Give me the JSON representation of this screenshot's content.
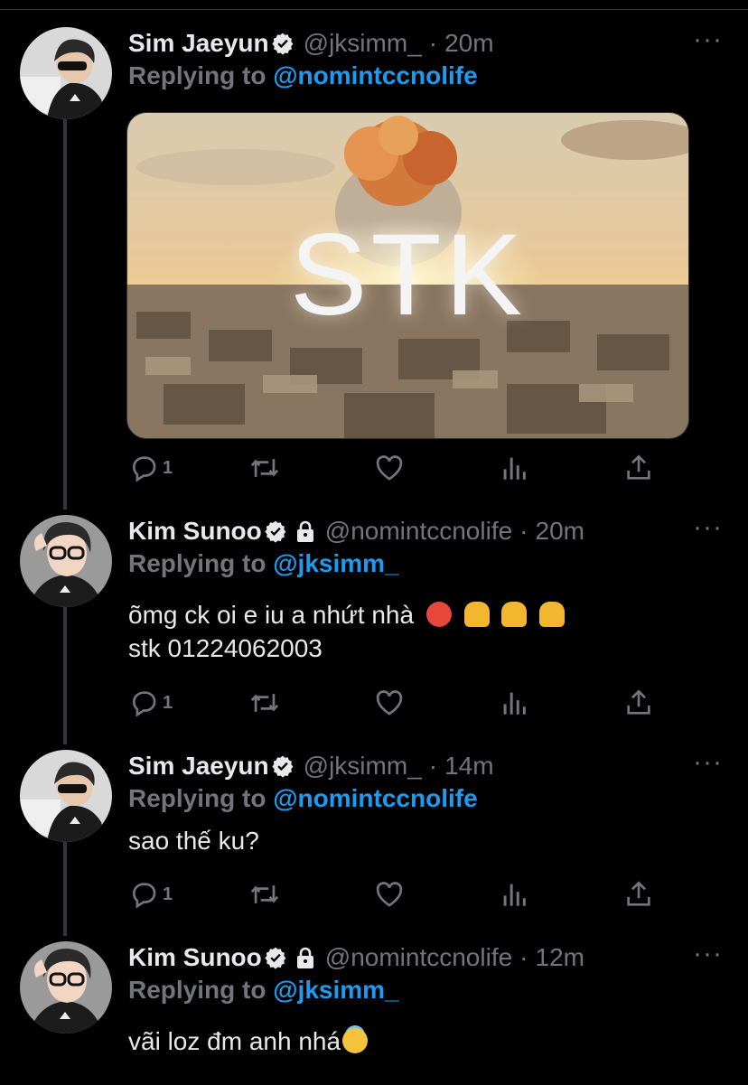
{
  "colors": {
    "background": "#000000",
    "accent": "#1d9bf0",
    "muted": "#71767b",
    "text": "#e7e9ea"
  },
  "tweets": [
    {
      "name": "Sim Jaeyun",
      "verified": true,
      "locked": false,
      "handle": "@jksimm_",
      "time": "20m",
      "replying_label": "Replying to ",
      "replying_to": "@nomintccnolife",
      "text": "",
      "media": {
        "label": "STK"
      },
      "reply_count": "1"
    },
    {
      "name": "Kim Sunoo",
      "verified": true,
      "locked": true,
      "handle": "@nomintccnolife",
      "time": "20m",
      "replying_label": "Replying to ",
      "replying_to": "@jksimm_",
      "text_line1": "õmg ck oi e iu a nhứt nhà",
      "text_line2": "stk 01224062003",
      "reply_count": "1"
    },
    {
      "name": "Sim Jaeyun",
      "verified": true,
      "locked": false,
      "handle": "@jksimm_",
      "time": "14m",
      "replying_label": "Replying to ",
      "replying_to": "@nomintccnolife",
      "text": "sao thế ku?",
      "reply_count": "1"
    },
    {
      "name": "Kim Sunoo",
      "verified": true,
      "locked": true,
      "handle": "@nomintccnolife",
      "time": "12m",
      "replying_label": "Replying to ",
      "replying_to": "@jksimm_",
      "text": "vãi loz đm anh nhá"
    }
  ],
  "separator": "·",
  "more_label": "···",
  "icons": [
    "reply-icon",
    "retweet-icon",
    "like-icon",
    "analytics-icon",
    "share-icon",
    "verified-badge-icon",
    "lock-icon"
  ]
}
